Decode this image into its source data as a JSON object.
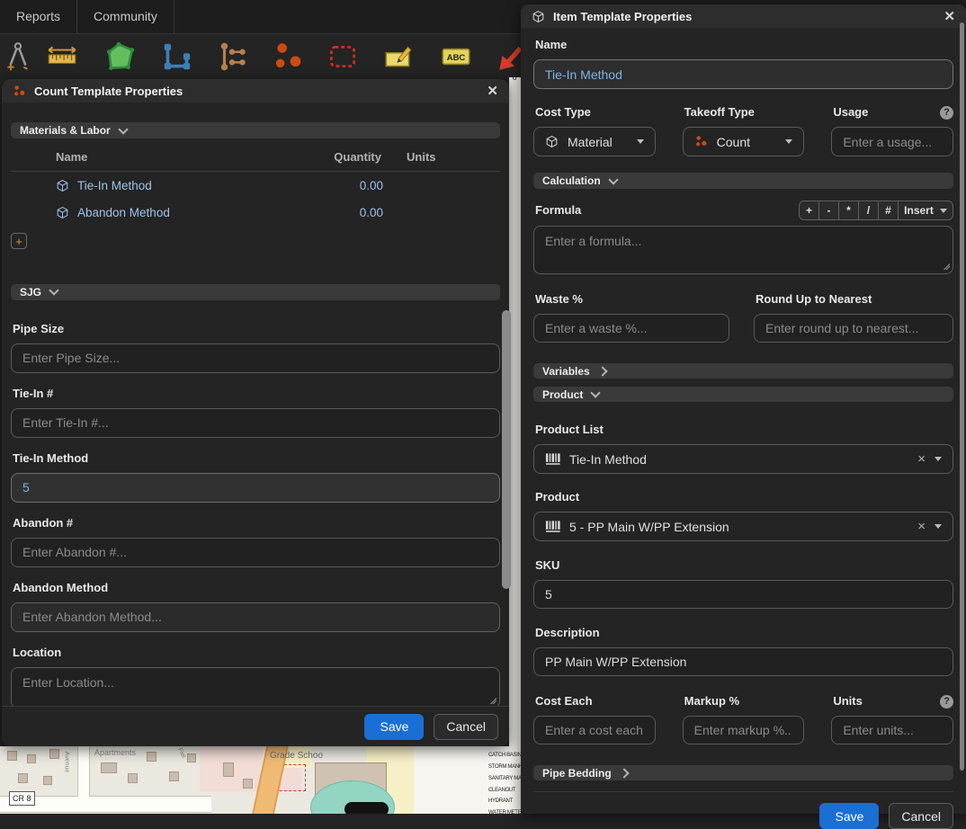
{
  "menu": {
    "items": [
      {
        "label": "Reports"
      },
      {
        "label": "Community"
      }
    ]
  },
  "toolbar": {
    "abc_label": "ABC"
  },
  "strip": {
    "stray": "o"
  },
  "count_panel": {
    "title": "Count Template Properties",
    "materials_labor_label": "Materials & Labor",
    "sjg_label": "SJG",
    "add_label": "+",
    "table": {
      "headers": [
        "Name",
        "Quantity",
        "Units"
      ],
      "rows": [
        {
          "name": "Tie-In Method",
          "quantity": "0.00",
          "units": ""
        },
        {
          "name": "Abandon Method",
          "quantity": "0.00",
          "units": ""
        }
      ]
    },
    "fields": [
      {
        "label": "Pipe Size",
        "placeholder": "Enter Pipe Size...",
        "value": ""
      },
      {
        "label": "Tie-In #",
        "placeholder": "Enter Tie-In #...",
        "value": ""
      },
      {
        "label": "Tie-In Method",
        "placeholder": "",
        "value": "5"
      },
      {
        "label": "Abandon #",
        "placeholder": "Enter Abandon #...",
        "value": ""
      },
      {
        "label": "Abandon Method",
        "placeholder": "Enter Abandon Method...",
        "value": ""
      },
      {
        "label": "Location",
        "placeholder": "Enter Location...",
        "value": ""
      }
    ],
    "save_label": "Save",
    "cancel_label": "Cancel"
  },
  "item_panel": {
    "title": "Item Template Properties",
    "name": {
      "label": "Name",
      "value": "Tie-In Method"
    },
    "cost_type": {
      "label": "Cost Type",
      "value": "Material"
    },
    "takeoff_type": {
      "label": "Takeoff Type",
      "value": "Count"
    },
    "usage": {
      "label": "Usage",
      "placeholder": "Enter a usage...",
      "help_glyph": "?"
    },
    "calculation": {
      "label": "Calculation",
      "formula": {
        "label": "Formula",
        "placeholder": "Enter a formula...",
        "ops": [
          "+",
          "-",
          "*",
          "/",
          "#"
        ],
        "insert_label": "Insert"
      },
      "waste": {
        "label": "Waste %",
        "placeholder": "Enter a waste %..."
      },
      "round_up": {
        "label": "Round Up to Nearest",
        "placeholder": "Enter round up to nearest..."
      }
    },
    "variables_label": "Variables",
    "product_label": "Product",
    "product": {
      "product_list": {
        "label": "Product List",
        "value": "Tie-In Method"
      },
      "product": {
        "label": "Product",
        "value": "5 - PP Main W/PP Extension"
      },
      "sku": {
        "label": "SKU",
        "value": "5"
      },
      "description": {
        "label": "Description",
        "value": "PP Main W/PP Extension"
      },
      "cost_each": {
        "label": "Cost Each",
        "placeholder": "Enter a cost each..."
      },
      "markup": {
        "label": "Markup %",
        "placeholder": "Enter markup %..."
      },
      "units": {
        "label": "Units",
        "placeholder": "Enter units...",
        "help_glyph": "?"
      }
    },
    "pipe_bedding_label": "Pipe Bedding",
    "save_label": "Save",
    "cancel_label": "Cancel"
  },
  "map": {
    "labels": {
      "apartments": "Apartments",
      "grade_school": "Grade Schoo",
      "cr8": "CR 8",
      "avenue": "Avenue",
      "field": "Fiel"
    },
    "legend": [
      "CATCH BASIN",
      "STORM MANH",
      "SANITARY MA",
      "CLEANOUT",
      "HYDRANT",
      "WATER METE"
    ]
  },
  "colors": {
    "accent_blue": "#1a6fd4",
    "link_blue": "#9cc3ea",
    "count_orange": "#cf4a12"
  }
}
